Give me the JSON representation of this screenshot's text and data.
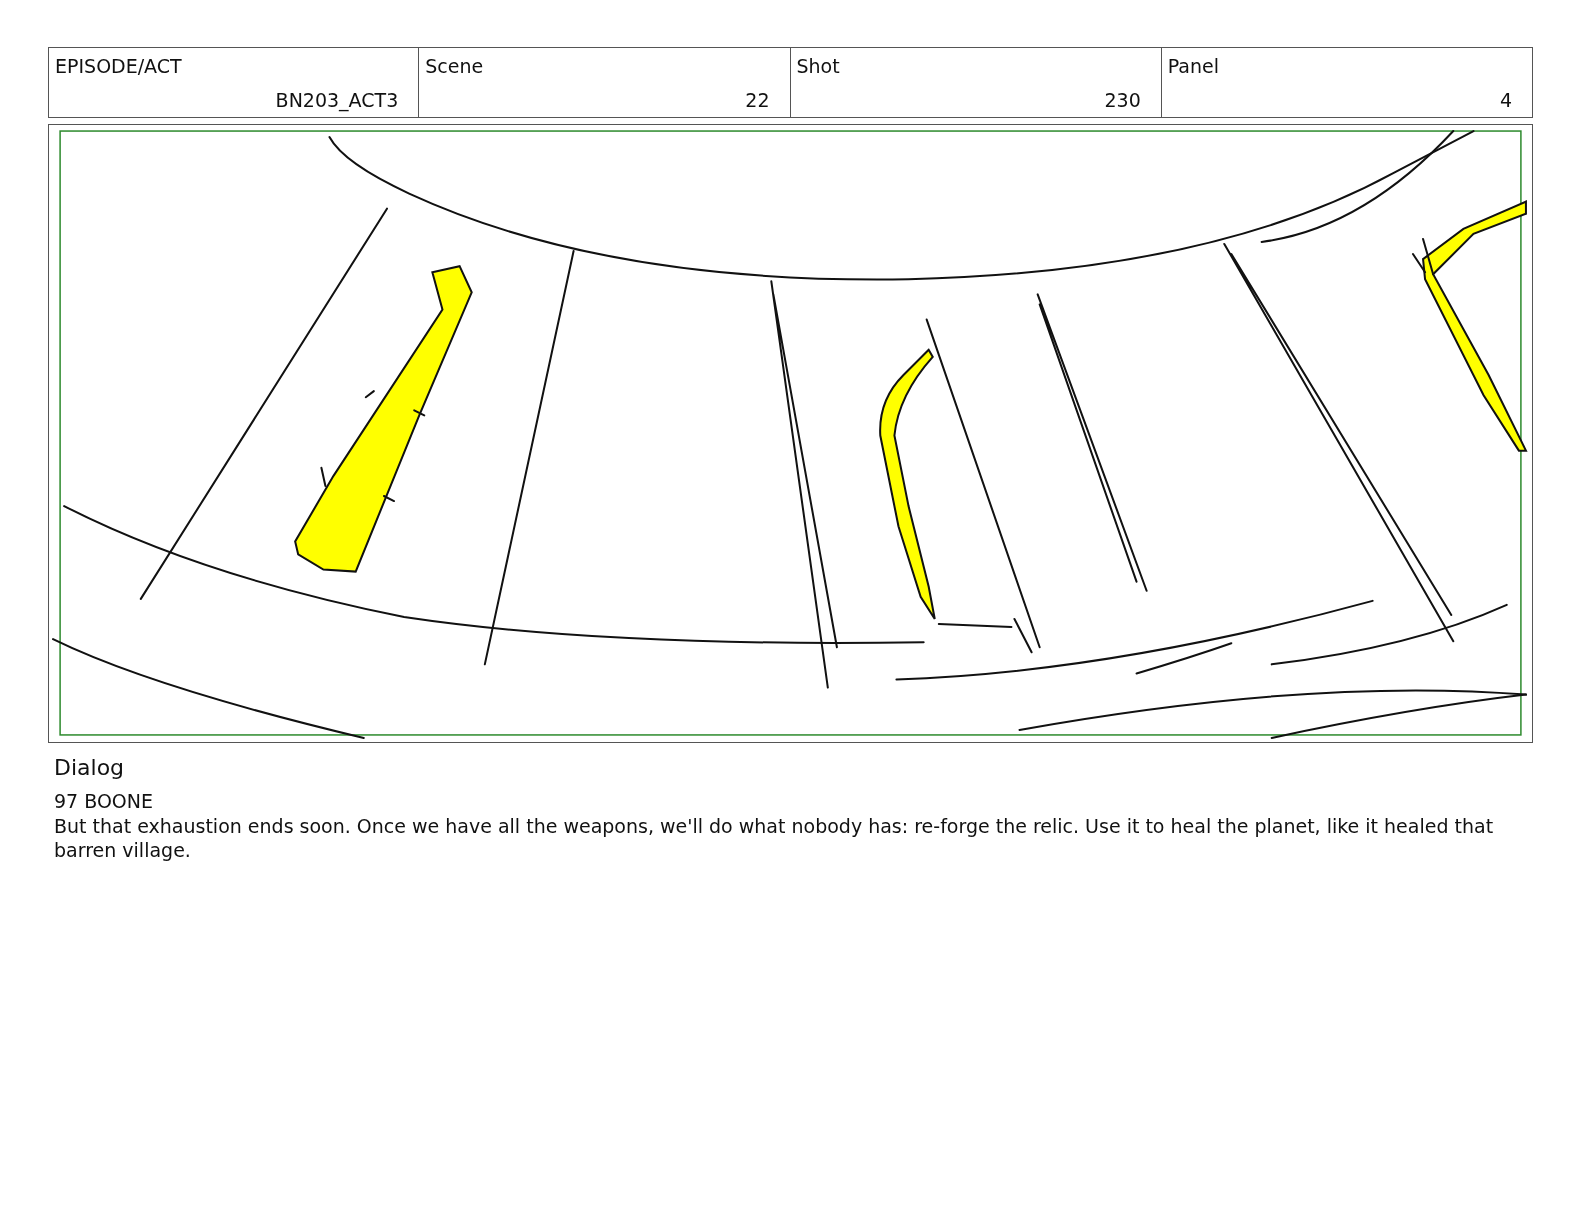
{
  "header": [
    {
      "label": "EPISODE/ACT",
      "value": "BN203_ACT3"
    },
    {
      "label": "Scene",
      "value": "22"
    },
    {
      "label": "Shot",
      "value": "230"
    },
    {
      "label": "Panel",
      "value": "4"
    }
  ],
  "dialog": {
    "title": "Dialog",
    "speaker": "97 BOONE",
    "line": "But that exhaustion ends soon. Once we have all the weapons, we'll do what nobody has: re-forge the relic. Use it to heal the planet, like it healed that barren village."
  }
}
